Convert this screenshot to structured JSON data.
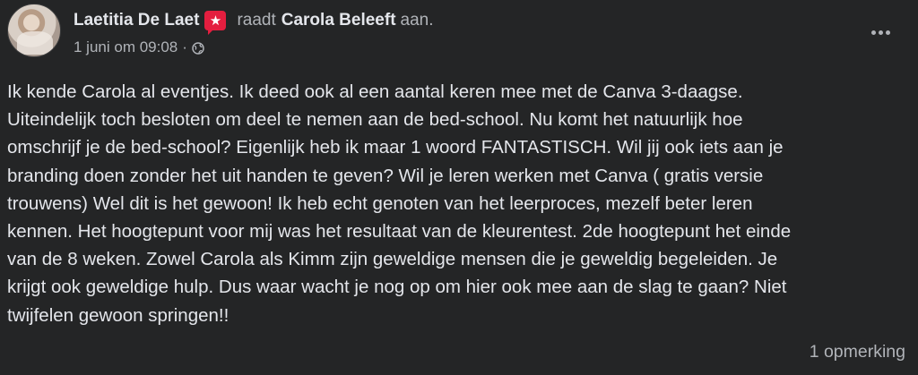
{
  "post": {
    "author": "Laetitia De Laet",
    "verb": "raadt",
    "target": "Carola Beleeft",
    "suffix": "aan.",
    "date": "1 juni om 09:08",
    "separator": "·",
    "privacy_icon": "globe-icon",
    "more_icon": "more-options-icon",
    "badge_icon": "recommendation-star-icon",
    "text": "Ik kende Carola al eventjes. Ik deed ook al een aantal keren mee met de Canva 3-daagse.\nUiteindelijk toch besloten om deel te nemen aan de bed-school. Nu komt het natuurlijk hoe\nomschrijf je de bed-school? Eigenlijk heb ik maar 1 woord FANTASTISCH. Wil jij ook iets aan je\nbranding doen zonder het uit handen te geven? Wil je leren werken met Canva ( gratis versie\ntrouwens) Wel dit is het gewoon! Ik heb echt genoten van het leerproces, mezelf beter leren\nkennen. Het hoogtepunt voor mij was het resultaat van de kleurentest. 2de hoogtepunt het einde\nvan de 8 weken. Zowel Carola als Kimm zijn geweldige mensen die je geweldig begeleiden. Je\nkrijgt ook geweldige hulp. Dus waar wacht je nog op om hier ook mee aan de slag te gaan? Niet\ntwijfelen gewoon springen!!",
    "comments": "1 opmerking"
  },
  "colors": {
    "background": "#242526",
    "primary_text": "#e4e6eb",
    "secondary_text": "#b0b3b8",
    "badge": "#e41e3f"
  }
}
